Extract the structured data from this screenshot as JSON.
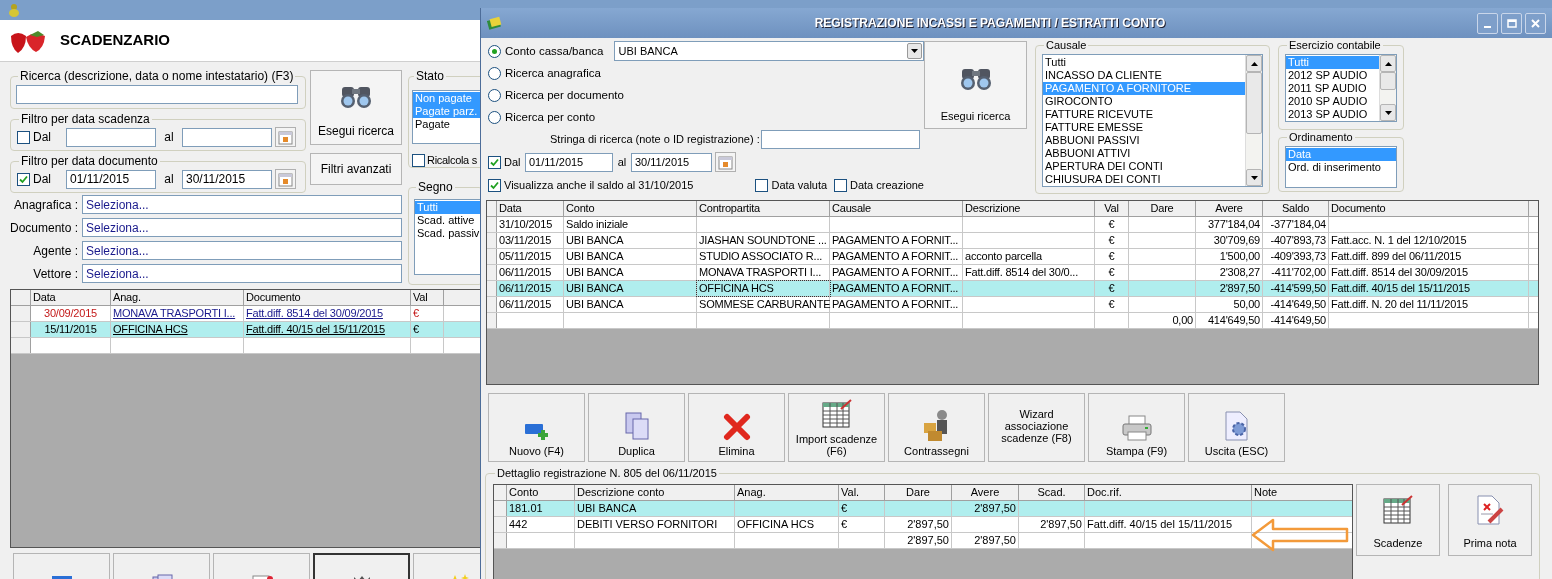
{
  "scadenzario": {
    "title": "SCADENZARIO",
    "search": {
      "label": "Ricerca (descrizione, data o nome intestatario) (F3)"
    },
    "due_filter": {
      "label": "Filtro per data scadenza",
      "dal": {
        "label": "Dal",
        "checked": false
      },
      "al": "al"
    },
    "doc_filter": {
      "label": "Filtro per data documento",
      "dal": {
        "label": "Dal",
        "checked": true
      },
      "from": "01/11/2015",
      "al": "al",
      "to": "30/11/2015"
    },
    "search_button": "Esegui ricerca",
    "advanced_button": "Filtri avanzati",
    "selectors": [
      {
        "label": "Anagrafica :",
        "value": "Seleziona..."
      },
      {
        "label": "Documento :",
        "value": "Seleziona..."
      },
      {
        "label": "Agente :",
        "value": "Seleziona..."
      },
      {
        "label": "Vettore :",
        "value": "Seleziona..."
      }
    ],
    "stato": {
      "label": "Stato",
      "items": [
        {
          "label": "Non pagate",
          "selected": true
        },
        {
          "label": "Pagate parz.",
          "selected": true
        },
        {
          "label": "Pagate",
          "selected": false
        }
      ]
    },
    "recalc": {
      "label": "Ricalcola s",
      "checked": false
    },
    "segno": {
      "label": "Segno",
      "items": [
        {
          "label": "Tutti",
          "selected": true
        },
        {
          "label": "Scad. attive",
          "selected": false
        },
        {
          "label": "Scad. passiv",
          "selected": false
        }
      ]
    },
    "table": {
      "columns": [
        "Data",
        "Anag.",
        "Documento",
        "Val"
      ],
      "rows": [
        {
          "cells": [
            "30/09/2015",
            "MONAVA TRASPORTI I...",
            "Fatt.diff. 8514 del 30/09/2015",
            "€"
          ],
          "selected": false,
          "overdue": true
        },
        {
          "cells": [
            "15/11/2015",
            "OFFICINA HCS",
            "Fatt.diff. 40/15 del 15/11/2015",
            "€"
          ],
          "selected": true,
          "overdue": false
        }
      ]
    }
  },
  "registration": {
    "title": "REGISTRAZIONE INCASSI E PAGAMENTI / ESTRATTI CONTO",
    "search_modes": [
      {
        "label": "Conto cassa/banca",
        "selected": true
      },
      {
        "label": "Ricerca anagrafica",
        "selected": false
      },
      {
        "label": "Ricerca per documento",
        "selected": false
      },
      {
        "label": "Ricerca per conto",
        "selected": false
      }
    ],
    "account": "UBI BANCA",
    "search_string": {
      "label": "Stringa di ricerca (note o ID registrazione) :"
    },
    "period": {
      "dal": {
        "label": "Dal",
        "checked": true
      },
      "from": "01/11/2015",
      "al": "al",
      "to": "30/11/2015"
    },
    "show_balance": {
      "label": "Visualizza anche il saldo al 31/10/2015",
      "checked": true
    },
    "value_date": {
      "label": "Data valuta",
      "checked": false
    },
    "creation_date": {
      "label": "Data creazione",
      "checked": false
    },
    "search_button": "Esegui ricerca",
    "causale": {
      "label": "Causale",
      "items": [
        {
          "label": "Tutti",
          "selected": false
        },
        {
          "label": "INCASSO DA CLIENTE",
          "selected": false
        },
        {
          "label": "PAGAMENTO A FORNITORE",
          "selected": true
        },
        {
          "label": "GIROCONTO",
          "selected": false
        },
        {
          "label": "FATTURE RICEVUTE",
          "selected": false
        },
        {
          "label": "FATTURE EMESSE",
          "selected": false
        },
        {
          "label": "ABBUONI PASSIVI",
          "selected": false
        },
        {
          "label": "ABBUONI ATTIVI",
          "selected": false
        },
        {
          "label": "APERTURA DEI CONTI",
          "selected": false
        },
        {
          "label": "CHIUSURA DEI CONTI",
          "selected": false
        }
      ]
    },
    "esercizio": {
      "label": "Esercizio contabile",
      "items": [
        {
          "label": "Tutti",
          "selected": true
        },
        {
          "label": "2012 SP AUDIO",
          "selected": false
        },
        {
          "label": "2011 SP AUDIO",
          "selected": false
        },
        {
          "label": "2010 SP AUDIO",
          "selected": false
        },
        {
          "label": "2013 SP AUDIO",
          "selected": false
        }
      ]
    },
    "ordinamento": {
      "label": "Ordinamento",
      "items": [
        {
          "label": "Data",
          "selected": true
        },
        {
          "label": "Ord. di inserimento",
          "selected": false
        }
      ]
    },
    "table": {
      "columns": [
        "Data",
        "Conto",
        "Contropartita",
        "Causale",
        "Descrizione",
        "Val",
        "Dare",
        "Avere",
        "Saldo",
        "Documento"
      ],
      "rows": [
        {
          "cells": [
            "31/10/2015",
            "Saldo iniziale",
            null,
            null,
            null,
            "€",
            null,
            "377'184,04",
            "-377'184,04",
            null
          ],
          "selected": false
        },
        {
          "cells": [
            "03/11/2015",
            "UBI BANCA",
            "JIASHAN SOUNDTONE ...",
            "PAGAMENTO A FORNIT...",
            null,
            "€",
            null,
            "30'709,69",
            "-407'893,73",
            "Fatt.acc. N. 1 del 12/10/2015"
          ],
          "selected": false
        },
        {
          "cells": [
            "05/11/2015",
            "UBI BANCA",
            "STUDIO ASSOCIATO R...",
            "PAGAMENTO A FORNIT...",
            "acconto parcella",
            "€",
            null,
            "1'500,00",
            "-409'393,73",
            "Fatt.diff. 899 del 06/11/2015"
          ],
          "selected": false
        },
        {
          "cells": [
            "06/11/2015",
            "UBI BANCA",
            "MONAVA TRASPORTI I...",
            "PAGAMENTO A FORNIT...",
            "Fatt.diff. 8514 del 30/0...",
            "€",
            null,
            "2'308,27",
            "-411'702,00",
            "Fatt.diff. 8514 del 30/09/2015"
          ],
          "selected": false
        },
        {
          "cells": [
            "06/11/2015",
            "UBI BANCA",
            "OFFICINA HCS",
            "PAGAMENTO A FORNIT...",
            null,
            "€",
            null,
            "2'897,50",
            "-414'599,50",
            "Fatt.diff. 40/15 del 15/11/2015"
          ],
          "selected": true
        },
        {
          "cells": [
            "06/11/2015",
            "UBI BANCA",
            "SOMMESE CARBURANTE",
            "PAGAMENTO A FORNIT...",
            null,
            "€",
            null,
            "50,00",
            "-414'649,50",
            "Fatt.diff. N. 20 del 11/11/2015"
          ],
          "selected": false
        },
        {
          "cells": [
            null,
            null,
            null,
            null,
            null,
            null,
            "0,00",
            "414'649,50",
            "-414'649,50",
            null
          ],
          "selected": false
        }
      ]
    },
    "toolbar": [
      "Nuovo (F4)",
      "Duplica",
      "Elimina",
      "Import scadenze (F6)",
      "Contrassegni",
      "Wizard associazione scadenze (F8)",
      "Stampa (F9)",
      "Uscita (ESC)"
    ],
    "detail": {
      "label": "Dettaglio registrazione N. 805 del 06/11/2015",
      "columns": [
        "Conto",
        "Descrizione conto",
        "Anag.",
        "Val.",
        "Dare",
        "Avere",
        "Scad.",
        "Doc.rif.",
        "Note"
      ],
      "rows": [
        {
          "cells": [
            "181.01",
            "UBI BANCA",
            null,
            "€",
            null,
            "2'897,50",
            null,
            null,
            null
          ],
          "selected": true
        },
        {
          "cells": [
            "442",
            "DEBITI VERSO FORNITORI",
            "OFFICINA HCS",
            "€",
            "2'897,50",
            null,
            "2'897,50",
            "Fatt.diff. 40/15 del 15/11/2015",
            null
          ],
          "selected": false
        },
        {
          "cells": [
            null,
            null,
            null,
            null,
            "2'897,50",
            "2'897,50",
            null,
            null,
            null
          ],
          "selected": false
        }
      ]
    },
    "side_buttons": [
      "Scadenze",
      "Prima nota"
    ]
  }
}
